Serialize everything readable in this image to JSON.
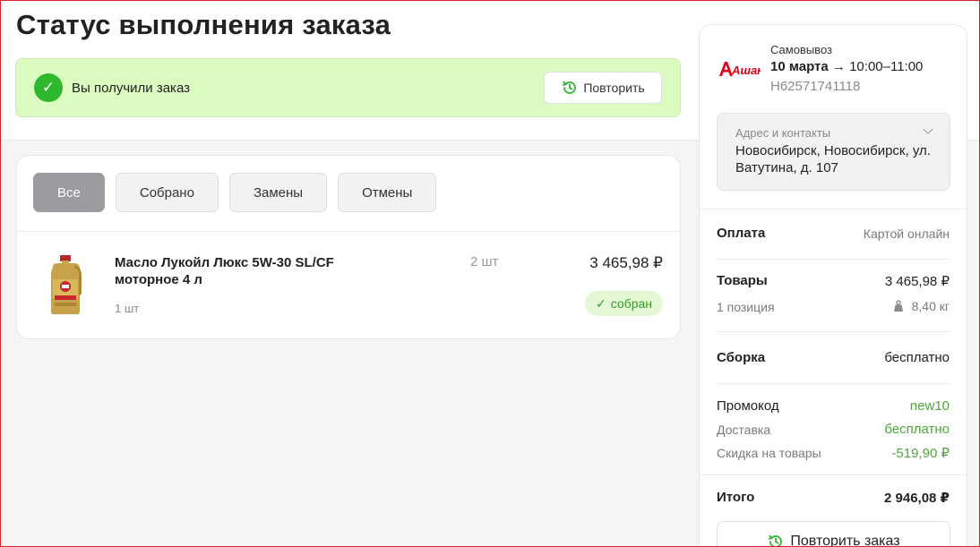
{
  "page": {
    "title": "Статус выполнения заказа"
  },
  "status_banner": {
    "text": "Вы получили заказ",
    "repeat_label": "Повторить"
  },
  "filters": {
    "all": "Все",
    "collected": "Собрано",
    "replacements": "Замены",
    "cancelled": "Отмены"
  },
  "product": {
    "name": "Масло Лукойл Люкс 5W-30 SL/CF моторное 4 л",
    "unit": "1 шт",
    "qty": "2 шт",
    "price": "3 465,98 ₽",
    "status": "собран"
  },
  "order": {
    "store_logo": "Ашан",
    "pickup_label": "Самовывоз",
    "date": "10 марта",
    "arrow": "→",
    "time": "10:00–11:00",
    "number": "H62571741118"
  },
  "address": {
    "caption": "Адрес и контакты",
    "value": "Новосибирск, Новосибирск, ул. Ватутина, д. 107"
  },
  "summary": {
    "payment_label": "Оплата",
    "payment_value": "Картой онлайн",
    "goods_label": "Товары",
    "goods_value": "3 465,98 ₽",
    "positions_label": "1 позиция",
    "weight_value": "8,40 кг",
    "assembly_label": "Сборка",
    "assembly_value": "бесплатно",
    "promo_label": "Промокод",
    "promo_value": "new10",
    "delivery_label": "Доставка",
    "delivery_value": "бесплатно",
    "discount_label": "Скидка на товары",
    "discount_value": "-519,90 ₽",
    "total_label": "Итого",
    "total_value": "2 946,08 ₽",
    "repeat_order_label": "Повторить заказ"
  },
  "colors": {
    "accent_green": "#2eb82e",
    "banner_bg": "#dcfbc1",
    "brand_red": "#e2001a",
    "active_tab": "#9b9ba0"
  }
}
